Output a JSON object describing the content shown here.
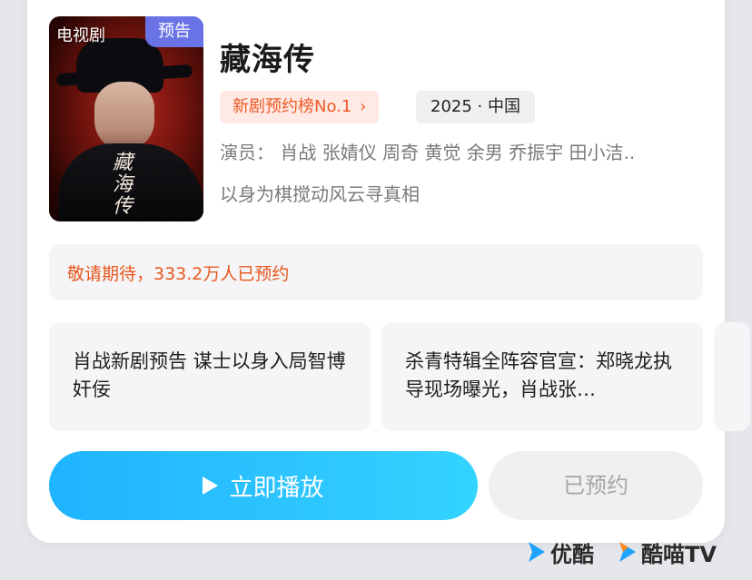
{
  "colors": {
    "accent_orange": "#f05a28",
    "notice_orange": "#e8571e",
    "play_blue": "#1fb4ff",
    "poster_tag_purple": "#6a73e6",
    "youku_blue": "#1fa3ff",
    "kumiao_orange": "#ff8a1f"
  },
  "poster": {
    "category": "电视剧",
    "badge": "预告",
    "calligraphy": "藏海传"
  },
  "show": {
    "title": "藏海传",
    "rank_label": "新剧预约榜No.1",
    "rank_chevron": "›",
    "meta": "2025 · 中国",
    "cast": "演员：  肖战 张婧仪 周奇 黄觉 余男 乔振宇 田小洁..",
    "slogan": "以身为棋搅动风云寻真相"
  },
  "notice": {
    "text": "敬请期待，333.2万人已预约"
  },
  "news": [
    {
      "text": "肖战新剧预告 谋士以身入局智博奸佞"
    },
    {
      "text": "杀青特辑全阵容官宣：郑晓龙执导现场曝光，肖战张…"
    }
  ],
  "actions": {
    "play_icon": "play-icon",
    "play_label": "立即播放",
    "reserved_label": "已预约"
  },
  "brands": [
    {
      "icon": "youku-icon",
      "label": "优酷"
    },
    {
      "icon": "kumiao-icon",
      "label": "酷喵TV"
    }
  ]
}
